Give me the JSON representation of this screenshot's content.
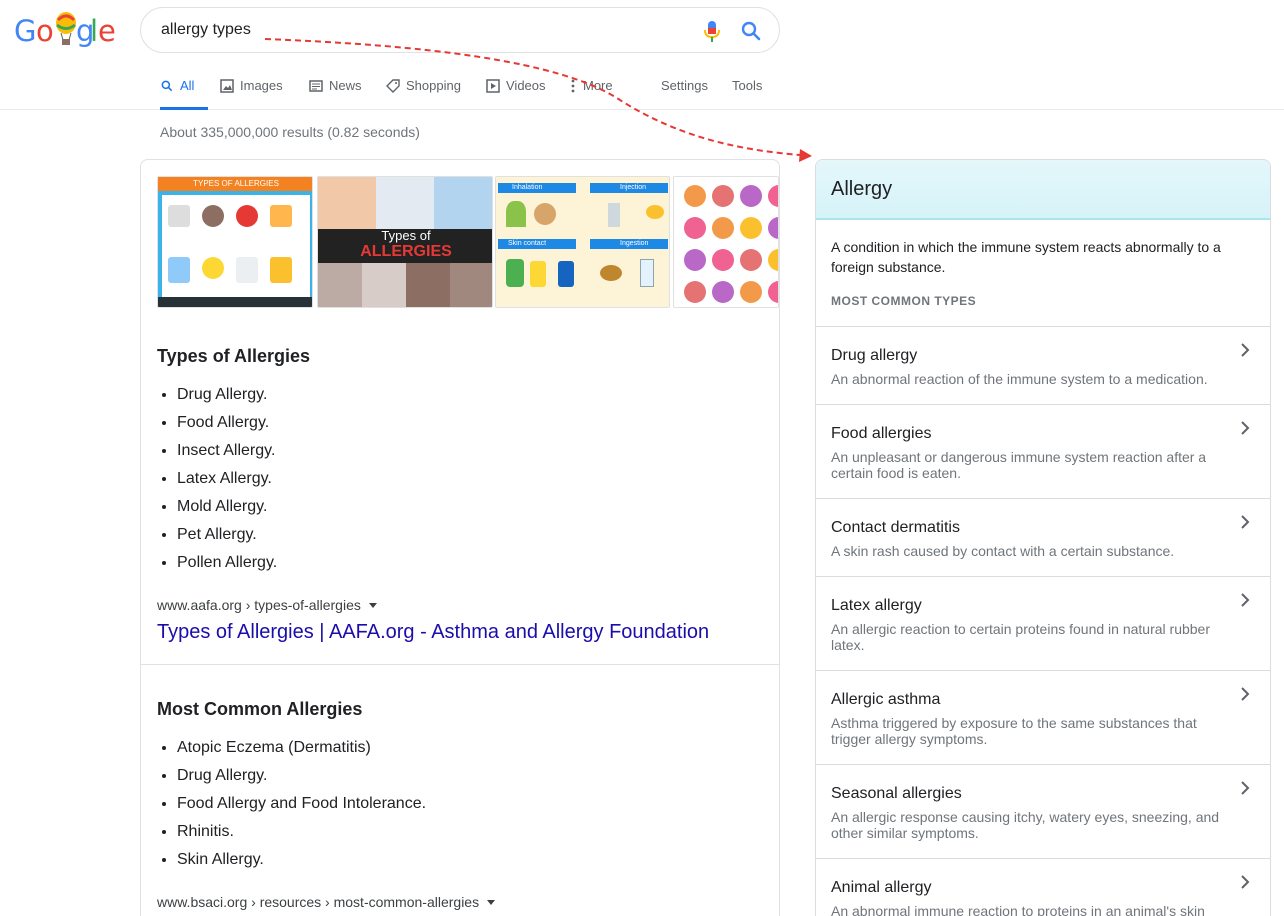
{
  "search": {
    "query": "allergy types"
  },
  "tabs": [
    {
      "label": "All",
      "icon": "search-icon",
      "active": true
    },
    {
      "label": "Images",
      "icon": "image-icon"
    },
    {
      "label": "News",
      "icon": "news-icon"
    },
    {
      "label": "Shopping",
      "icon": "tag-icon"
    },
    {
      "label": "Videos",
      "icon": "play-icon"
    },
    {
      "label": "More",
      "icon": "more-vert-icon"
    },
    {
      "label": "Settings"
    },
    {
      "label": "Tools"
    }
  ],
  "stats": "About 335,000,000 results (0.82 seconds)",
  "thumbnails": {
    "first_title": "TYPES OF ALLERGIES",
    "second_title_a": "Types of",
    "second_title_b": "ALLERGIES",
    "third_labels": [
      "Inhalation",
      "Injection",
      "Skin contact",
      "Ingestion"
    ]
  },
  "results": [
    {
      "title": "Types of Allergies",
      "items": [
        "Drug Allergy.",
        "Food Allergy.",
        "Insect Allergy.",
        "Latex Allergy.",
        "Mold Allergy.",
        "Pet Allergy.",
        "Pollen Allergy."
      ],
      "url": "www.aafa.org › types-of-allergies",
      "link": "Types of Allergies | AAFA.org - Asthma and Allergy Foundation"
    },
    {
      "title": "Most Common Allergies",
      "items": [
        "Atopic Eczema (Dermatitis)",
        "Drug Allergy.",
        "Food Allergy and Food Intolerance.",
        "Rhinitis.",
        "Skin Allergy."
      ],
      "url": "www.bsaci.org › resources › most-common-allergies"
    }
  ],
  "knowledge_panel": {
    "title": "Allergy",
    "description": "A condition in which the immune system reacts abnormally to a foreign substance.",
    "subhead": "MOST COMMON TYPES",
    "items": [
      {
        "title": "Drug allergy",
        "desc": "An abnormal reaction of the immune system to a medication."
      },
      {
        "title": "Food allergies",
        "desc": "An unpleasant or dangerous immune system reaction after a certain food is eaten."
      },
      {
        "title": "Contact dermatitis",
        "desc": "A skin rash caused by contact with a certain substance."
      },
      {
        "title": "Latex allergy",
        "desc": "An allergic reaction to certain proteins found in natural rubber latex."
      },
      {
        "title": "Allergic asthma",
        "desc": "Asthma triggered by exposure to the same substances that trigger allergy symptoms."
      },
      {
        "title": "Seasonal allergies",
        "desc": "An allergic response causing itchy, watery eyes, sneezing, and other similar symptoms."
      },
      {
        "title": "Animal allergy",
        "desc": "An abnormal immune reaction to proteins in an animal's skin"
      }
    ]
  },
  "colors": {
    "accent": "#1a73e8",
    "link": "#1a0dab",
    "annotation_arrow": "#e53935"
  }
}
